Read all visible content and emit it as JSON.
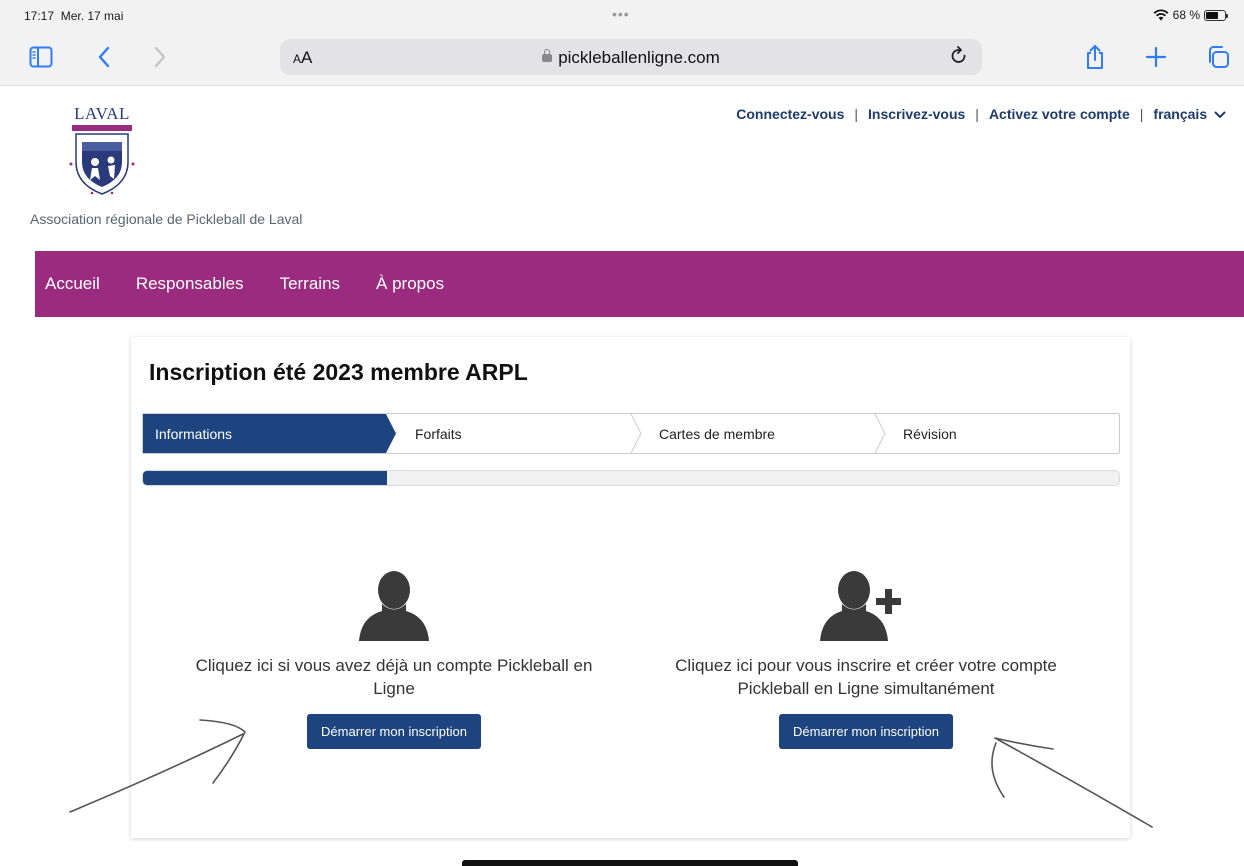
{
  "status": {
    "time": "17:17",
    "date": "Mer. 17 mai",
    "battery": "68 %",
    "battery_level": 0.68
  },
  "browser": {
    "text_size_label": "AA",
    "url": "pickleballenligne.com",
    "icons": [
      "sidebar-icon",
      "back-icon",
      "forward-icon",
      "reload-icon",
      "share-icon",
      "new-tab-icon",
      "tabs-icon"
    ]
  },
  "site": {
    "logo_text": "LAVAL",
    "association_name": "Association régionale de Pickleball de Laval",
    "top_links": {
      "login": "Connectez-vous",
      "register": "Inscrivez-vous",
      "activate": "Activez votre compte",
      "separator": "|",
      "language": "français"
    },
    "nav": {
      "home": "Accueil",
      "managers": "Responsables",
      "courts": "Terrains",
      "about": "À propos"
    },
    "colors": {
      "nav_bg": "#9b2b7f",
      "primary": "#1d447e"
    }
  },
  "form": {
    "title": "Inscription été 2023 membre ARPL",
    "steps": [
      "Informations",
      "Forfaits",
      "Cartes de membre",
      "Révision"
    ],
    "active_step": 0,
    "progress": 0.25,
    "options": [
      {
        "text": "Cliquez ici si vous avez déjà un compte Pickleball en Ligne",
        "button": "Démarrer mon inscription",
        "icon": "user-icon"
      },
      {
        "text": "Cliquez ici pour vous inscrire et créer votre compte Pickleball en Ligne simultanément",
        "button": "Démarrer mon inscription",
        "icon": "add-user-icon"
      }
    ]
  }
}
